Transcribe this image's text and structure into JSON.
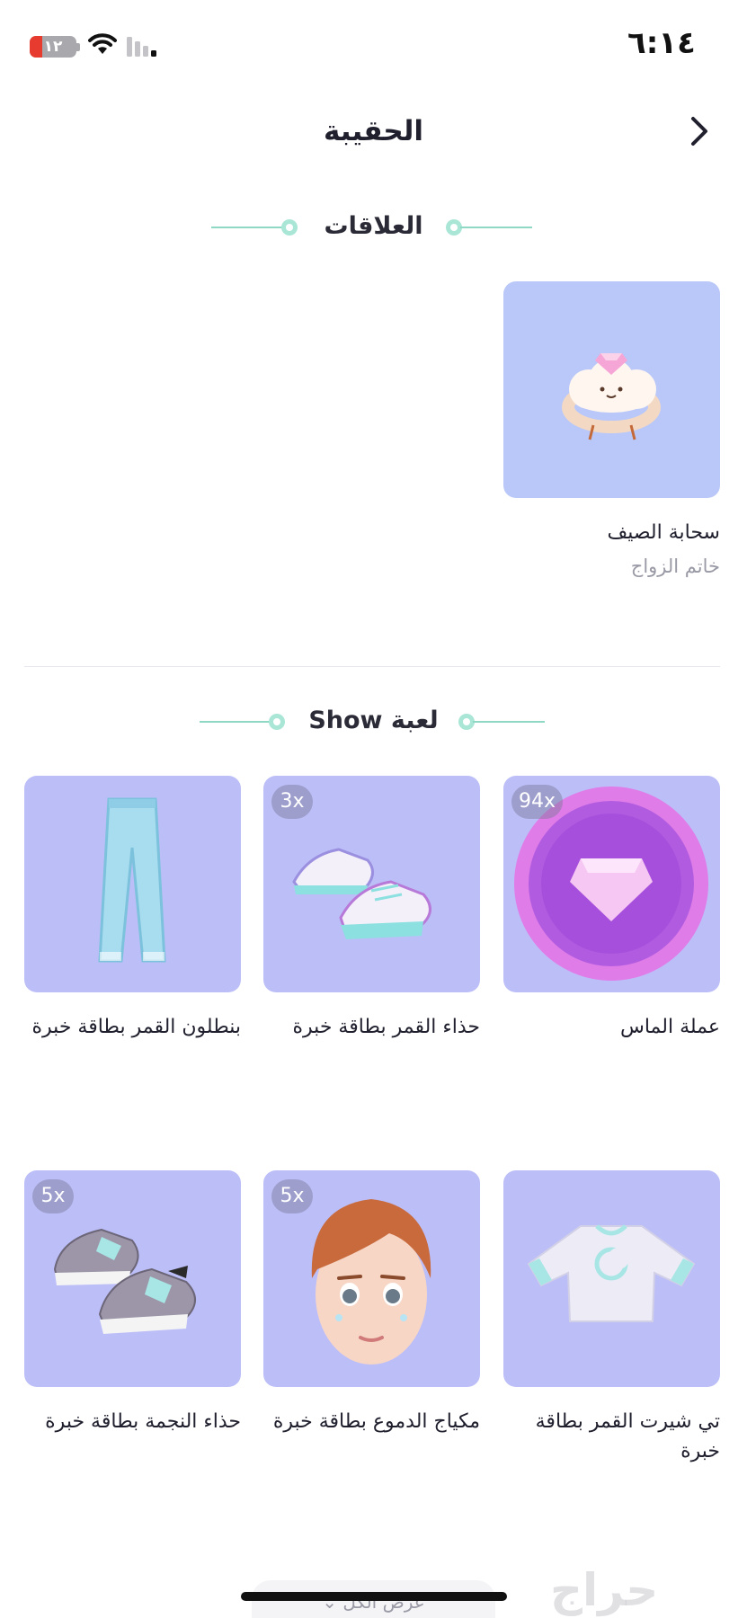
{
  "status_bar": {
    "time": "٦:١٤",
    "battery": "١٢"
  },
  "header": {
    "title": "الحقيبة",
    "back_icon": "chevron-right-icon"
  },
  "sections": {
    "relationships": {
      "title": "العلاقات",
      "items": [
        {
          "name": "سحابة الصيف",
          "subtitle": "خاتم الزواج",
          "icon": "cloud-ring-icon"
        }
      ]
    },
    "show_game": {
      "title": "لعبة Show",
      "items": [
        {
          "name": "عملة الماس",
          "quantity": "94x",
          "icon": "diamond-coin-icon"
        },
        {
          "name": "حذاء القمر بطاقة خبرة",
          "quantity": "3x",
          "icon": "moon-sneakers-icon"
        },
        {
          "name": "بنطلون القمر بطاقة خبرة",
          "quantity": "",
          "icon": "moon-pants-icon"
        },
        {
          "name": "تي شيرت القمر بطاقة خبرة",
          "quantity": "",
          "icon": "moon-tshirt-icon"
        },
        {
          "name": "مكياج الدموع بطاقة خبرة",
          "quantity": "5x",
          "icon": "avatar-face-icon"
        },
        {
          "name": "حذاء النجمة بطاقة خبرة",
          "quantity": "5x",
          "icon": "star-sneakers-icon"
        }
      ]
    }
  },
  "footer": {
    "view_all": "عرض الكل",
    "watermark": "حراج"
  },
  "colors": {
    "card_purple": "#bcbef8",
    "card_blue": "#b9c8f8",
    "accent_mint": "#8fd8c4"
  }
}
